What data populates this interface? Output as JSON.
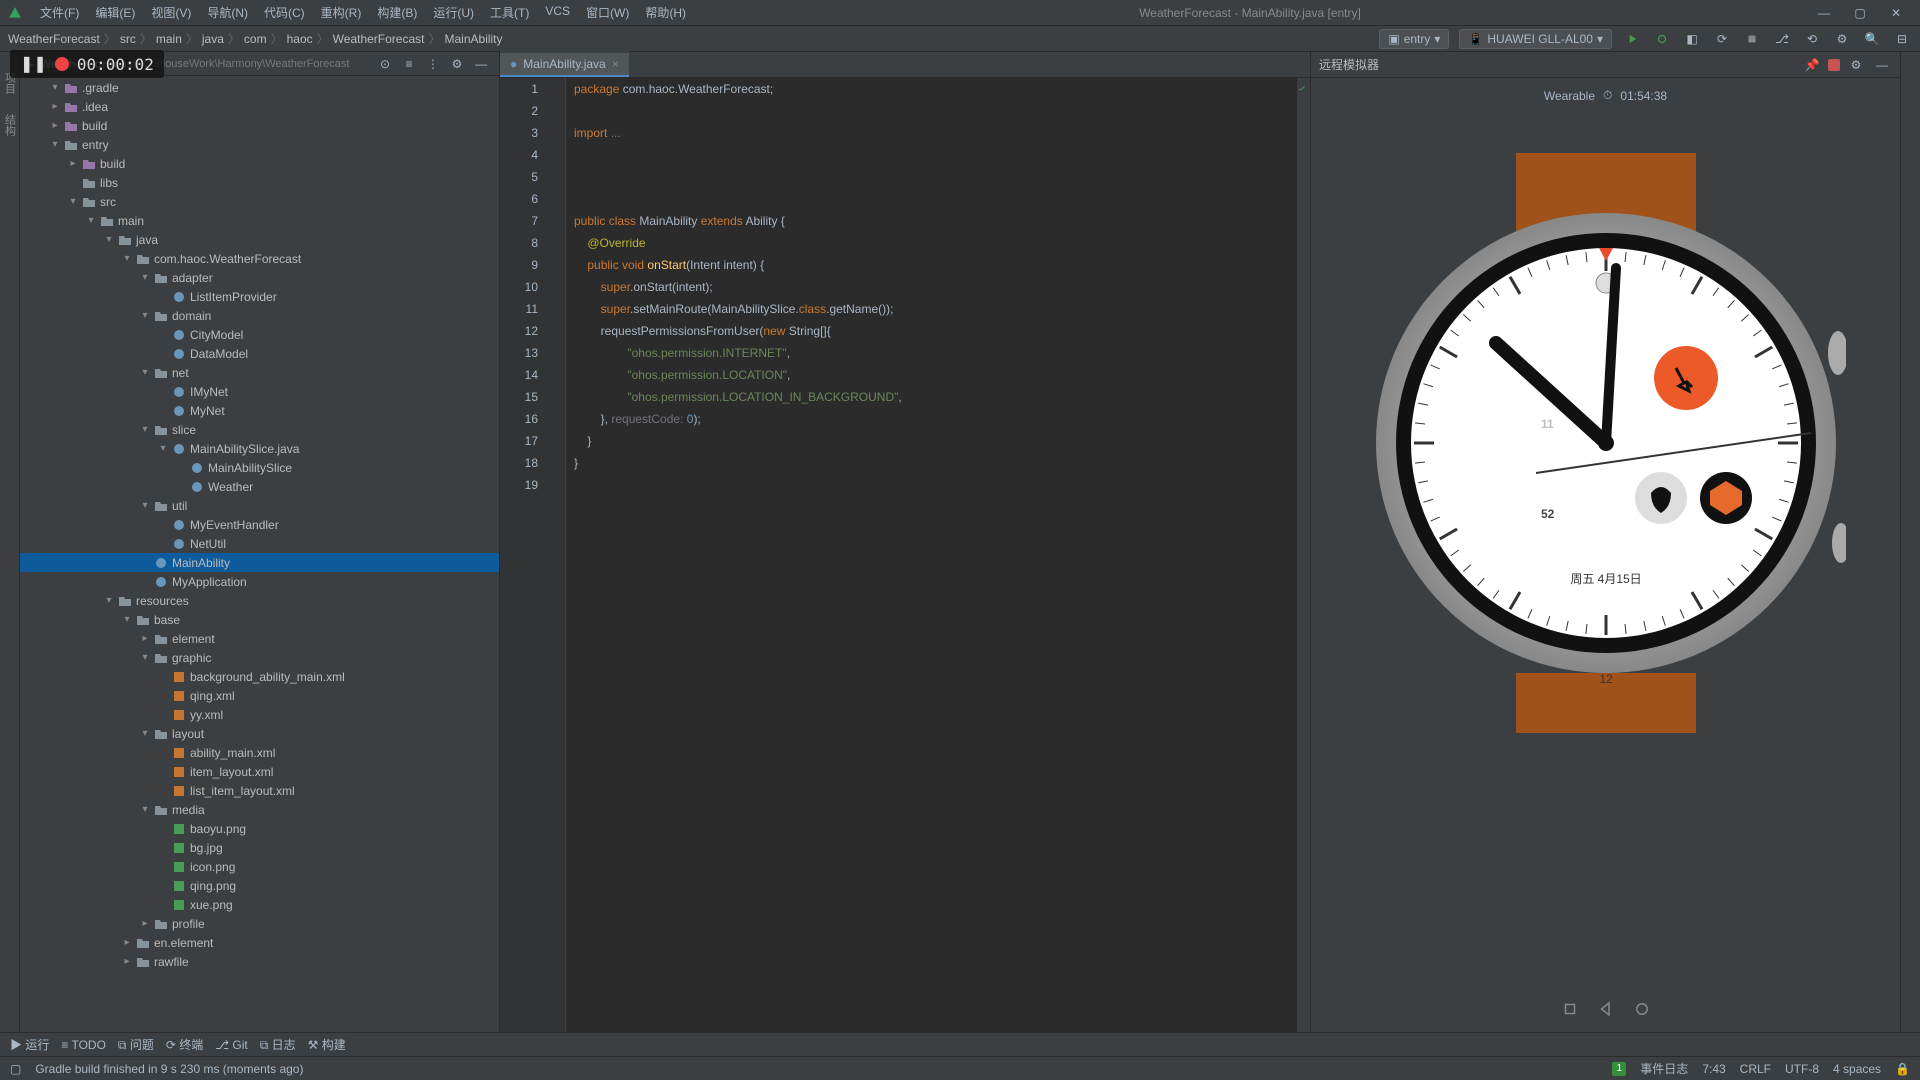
{
  "title": "WeatherForecast - MainAbility.java [entry]",
  "menus": [
    "文件(F)",
    "编辑(E)",
    "视图(V)",
    "导航(N)",
    "代码(C)",
    "重构(R)",
    "构建(B)",
    "运行(U)",
    "工具(T)",
    "VCS",
    "窗口(W)",
    "帮助(H)"
  ],
  "breadcrumb": [
    "WeatherForecast",
    "src",
    "main",
    "java",
    "com",
    "haoc",
    "WeatherForecast",
    "MainAbility"
  ],
  "run_config": {
    "module": "entry",
    "device": "HUAWEI GLL-AL00"
  },
  "rec_time": "00:00:02",
  "proj_name": "WeatherForecast",
  "proj_path": "D:\\HouseWork\\Harmony\\WeatherForecast",
  "tree": [
    {
      "d": 0,
      "a": "v",
      "i": "folder-sp",
      "t": ".gradle"
    },
    {
      "d": 0,
      "a": "r",
      "i": "folder-sp",
      "t": ".idea"
    },
    {
      "d": 0,
      "a": "r",
      "i": "folder-sp",
      "t": "build"
    },
    {
      "d": 0,
      "a": "v",
      "i": "folder",
      "t": "entry"
    },
    {
      "d": 1,
      "a": "r",
      "i": "folder-sp",
      "t": "build"
    },
    {
      "d": 1,
      "a": "",
      "i": "folder",
      "t": "libs"
    },
    {
      "d": 1,
      "a": "v",
      "i": "folder",
      "t": "src"
    },
    {
      "d": 2,
      "a": "v",
      "i": "folder",
      "t": "main"
    },
    {
      "d": 3,
      "a": "v",
      "i": "folder",
      "t": "java"
    },
    {
      "d": 4,
      "a": "v",
      "i": "folder",
      "t": "com.haoc.WeatherForecast"
    },
    {
      "d": 5,
      "a": "v",
      "i": "folder",
      "t": "adapter"
    },
    {
      "d": 6,
      "a": "",
      "i": "file-java",
      "t": "ListItemProvider"
    },
    {
      "d": 5,
      "a": "v",
      "i": "folder",
      "t": "domain"
    },
    {
      "d": 6,
      "a": "",
      "i": "file-java",
      "t": "CityModel"
    },
    {
      "d": 6,
      "a": "",
      "i": "file-java",
      "t": "DataModel"
    },
    {
      "d": 5,
      "a": "v",
      "i": "folder",
      "t": "net"
    },
    {
      "d": 6,
      "a": "",
      "i": "file-java",
      "t": "IMyNet"
    },
    {
      "d": 6,
      "a": "",
      "i": "file-java",
      "t": "MyNet"
    },
    {
      "d": 5,
      "a": "v",
      "i": "folder",
      "t": "slice"
    },
    {
      "d": 6,
      "a": "v",
      "i": "file-java",
      "t": "MainAbilitySlice.java"
    },
    {
      "d": 7,
      "a": "",
      "i": "file-java",
      "t": "MainAbilitySlice"
    },
    {
      "d": 7,
      "a": "",
      "i": "file-java",
      "t": "Weather"
    },
    {
      "d": 5,
      "a": "v",
      "i": "folder",
      "t": "util"
    },
    {
      "d": 6,
      "a": "",
      "i": "file-java",
      "t": "MyEventHandler"
    },
    {
      "d": 6,
      "a": "",
      "i": "file-java",
      "t": "NetUtil"
    },
    {
      "d": 5,
      "a": "",
      "i": "file-java",
      "t": "MainAbility",
      "sel": true
    },
    {
      "d": 5,
      "a": "",
      "i": "file-java",
      "t": "MyApplication"
    },
    {
      "d": 3,
      "a": "v",
      "i": "folder",
      "t": "resources"
    },
    {
      "d": 4,
      "a": "v",
      "i": "folder",
      "t": "base"
    },
    {
      "d": 5,
      "a": "r",
      "i": "folder",
      "t": "element"
    },
    {
      "d": 5,
      "a": "v",
      "i": "folder",
      "t": "graphic"
    },
    {
      "d": 6,
      "a": "",
      "i": "file-xml",
      "t": "background_ability_main.xml"
    },
    {
      "d": 6,
      "a": "",
      "i": "file-xml",
      "t": "qing.xml"
    },
    {
      "d": 6,
      "a": "",
      "i": "file-xml",
      "t": "yy.xml"
    },
    {
      "d": 5,
      "a": "v",
      "i": "folder",
      "t": "layout"
    },
    {
      "d": 6,
      "a": "",
      "i": "file-xml",
      "t": "ability_main.xml"
    },
    {
      "d": 6,
      "a": "",
      "i": "file-xml",
      "t": "item_layout.xml"
    },
    {
      "d": 6,
      "a": "",
      "i": "file-xml",
      "t": "list_item_layout.xml"
    },
    {
      "d": 5,
      "a": "v",
      "i": "folder",
      "t": "media"
    },
    {
      "d": 6,
      "a": "",
      "i": "file-img",
      "t": "baoyu.png"
    },
    {
      "d": 6,
      "a": "",
      "i": "file-img",
      "t": "bg.jpg"
    },
    {
      "d": 6,
      "a": "",
      "i": "file-img",
      "t": "icon.png"
    },
    {
      "d": 6,
      "a": "",
      "i": "file-img",
      "t": "qing.png"
    },
    {
      "d": 6,
      "a": "",
      "i": "file-img",
      "t": "xue.png"
    },
    {
      "d": 5,
      "a": "r",
      "i": "folder",
      "t": "profile"
    },
    {
      "d": 4,
      "a": "r",
      "i": "folder",
      "t": "en.element"
    },
    {
      "d": 4,
      "a": "r",
      "i": "folder",
      "t": "rawfile"
    }
  ],
  "tab_name": "MainAbility.java",
  "code_lines": [
    {
      "n": 1,
      "s": [
        [
          "kw",
          "package"
        ],
        [
          "",
          " com.haoc.WeatherForecast;"
        ]
      ]
    },
    {
      "n": 2,
      "s": []
    },
    {
      "n": 3,
      "s": [
        [
          "kw",
          "import"
        ],
        [
          "",
          " "
        ],
        [
          "param",
          "..."
        ]
      ]
    },
    {
      "n": 4,
      "s": []
    },
    {
      "n": 5,
      "s": []
    },
    {
      "n": 6,
      "s": []
    },
    {
      "n": 7,
      "s": [
        [
          "kw",
          "public class"
        ],
        [
          "",
          " "
        ],
        [
          "cls",
          "MainAbility"
        ],
        [
          "",
          " "
        ],
        [
          "kw",
          "extends"
        ],
        [
          "",
          " "
        ],
        [
          "cls",
          "Ability"
        ],
        [
          "",
          " {"
        ]
      ]
    },
    {
      "n": 8,
      "s": [
        [
          "",
          "    "
        ],
        [
          "ann",
          "@Override"
        ]
      ]
    },
    {
      "n": 9,
      "s": [
        [
          "",
          "    "
        ],
        [
          "kw",
          "public void"
        ],
        [
          "",
          " "
        ],
        [
          "fn",
          "onStart"
        ],
        [
          "",
          "(Intent intent) {"
        ]
      ]
    },
    {
      "n": 10,
      "s": [
        [
          "",
          "        "
        ],
        [
          "kw",
          "super"
        ],
        [
          "",
          ".onStart(intent);"
        ]
      ]
    },
    {
      "n": 11,
      "s": [
        [
          "",
          "        "
        ],
        [
          "kw",
          "super"
        ],
        [
          "",
          ".setMainRoute(MainAbilitySlice."
        ],
        [
          "kw",
          "class"
        ],
        [
          "",
          ".getName());"
        ]
      ]
    },
    {
      "n": 12,
      "s": [
        [
          "",
          "        requestPermissionsFromUser("
        ],
        [
          "kw",
          "new"
        ],
        [
          "",
          " String[]{"
        ]
      ]
    },
    {
      "n": 13,
      "s": [
        [
          "",
          "                "
        ],
        [
          "str",
          "\"ohos.permission.INTERNET\""
        ],
        [
          "",
          ","
        ]
      ]
    },
    {
      "n": 14,
      "s": [
        [
          "",
          "                "
        ],
        [
          "str",
          "\"ohos.permission.LOCATION\""
        ],
        [
          "",
          ","
        ]
      ]
    },
    {
      "n": 15,
      "s": [
        [
          "",
          "                "
        ],
        [
          "str",
          "\"ohos.permission.LOCATION_IN_BACKGROUND\""
        ],
        [
          "",
          ","
        ]
      ]
    },
    {
      "n": 16,
      "s": [
        [
          "",
          "        }, "
        ],
        [
          "param",
          "requestCode:"
        ],
        [
          "",
          " "
        ],
        [
          "num",
          "0"
        ],
        [
          "",
          ");"
        ]
      ]
    },
    {
      "n": 17,
      "s": [
        [
          "",
          "    }"
        ]
      ]
    },
    {
      "n": 18,
      "s": [
        [
          "",
          "}"
        ]
      ]
    },
    {
      "n": 19,
      "s": []
    }
  ],
  "previewer": {
    "label": "远程模拟器",
    "name": "Wearable",
    "clock_icon": "⏱",
    "time": "01:54:38"
  },
  "watch": {
    "hour_big": "11",
    "min_big": "52",
    "date": "周五 4月15日"
  },
  "bottom_tools": [
    "▶ 运行",
    "≡ TODO",
    "⧉ 问题",
    "⟳ 终端",
    "⎇ Git",
    "⧉ 日志",
    "⚒ 构建"
  ],
  "status": {
    "msg": "Gradle build finished in 9 s 230 ms (moments ago)",
    "ev": "1",
    "ev_label": "事件日志",
    "pos": "7:43",
    "le": "CRLF",
    "enc": "UTF-8",
    "indent": "4 spaces"
  }
}
